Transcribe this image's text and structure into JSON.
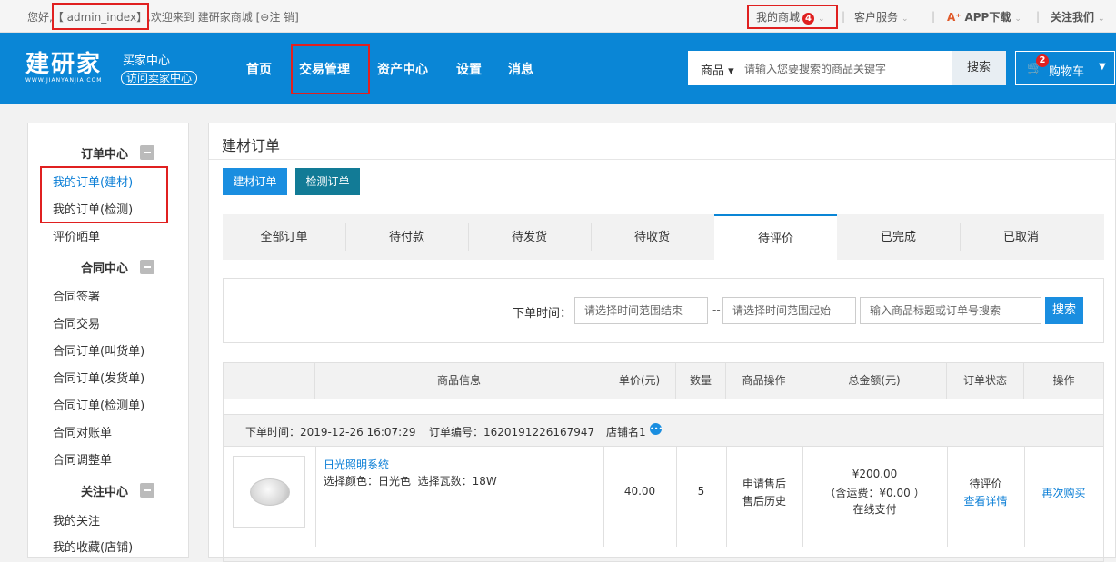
{
  "topbar": {
    "greeting": "您好,",
    "username": "【 admin_index】",
    "welcome": ",欢迎来到",
    "mall": "建研家商城",
    "logout": "[⊖注 销]",
    "my_mall": "我的商城",
    "my_mall_badge": "4",
    "service": "客户服务",
    "app_download": "APP下载",
    "follow": "关注我们"
  },
  "header": {
    "logo_text": "建研家",
    "logo_url": "WWW.JIANYANJIA.COM",
    "buyer_center": "买家中心",
    "seller_center": "访问卖家中心",
    "nav": [
      "首页",
      "交易管理",
      "资产中心",
      "设置",
      "消息"
    ],
    "search_category": "商品",
    "search_placeholder": "请输入您要搜索的商品关键字",
    "search_button": "搜索",
    "cart_badge": "2",
    "cart_label": "购物车"
  },
  "sidebar": {
    "sections": [
      {
        "title": "订单中心",
        "items": [
          "我的订单(建材)",
          "我的订单(检测)",
          "评价晒单"
        ]
      },
      {
        "title": "合同中心",
        "items": [
          "合同签署",
          "合同交易",
          "合同订单(叫货单)",
          "合同订单(发货单)",
          "合同订单(检测单)",
          "合同对账单",
          "合同调整单"
        ]
      },
      {
        "title": "关注中心",
        "items": [
          "我的关注",
          "我的收藏(店铺)"
        ]
      }
    ]
  },
  "main": {
    "title": "建材订单",
    "btn_building": "建材订单",
    "btn_testing": "检测订单",
    "tabs": [
      "全部订单",
      "待付款",
      "待发货",
      "待收货",
      "待评价",
      "已完成",
      "已取消"
    ],
    "filter": {
      "label": "下单时间：",
      "end_placeholder": "请选择时间范围结束",
      "dash": "--",
      "start_placeholder": "请选择时间范围起始",
      "keyword_placeholder": "输入商品标题或订单号搜索",
      "search": "搜索"
    },
    "table": {
      "headers": [
        "商品信息",
        "单价(元)",
        "数量",
        "商品操作",
        "总金额(元)",
        "订单状态",
        "操作"
      ],
      "order": {
        "time": "下单时间：2019-12-26 16:07:29",
        "number": "订单编号：1620191226167947",
        "shop": "店铺名1",
        "product_name": "日光照明系统",
        "spec": "选择颜色：日光色  选择瓦数：18W",
        "price": "40.00",
        "qty": "5",
        "op1": "申请售后",
        "op2": "售后历史",
        "total": "¥200.00",
        "freight": "（含运费：¥0.00 ）",
        "pay": "在线支付",
        "status": "待评价",
        "detail": "查看详情",
        "rebuy": "再次购买"
      }
    }
  },
  "colors": {
    "brand_blue": "#0a86d6",
    "teal": "#127b96",
    "red": "#e02020"
  }
}
